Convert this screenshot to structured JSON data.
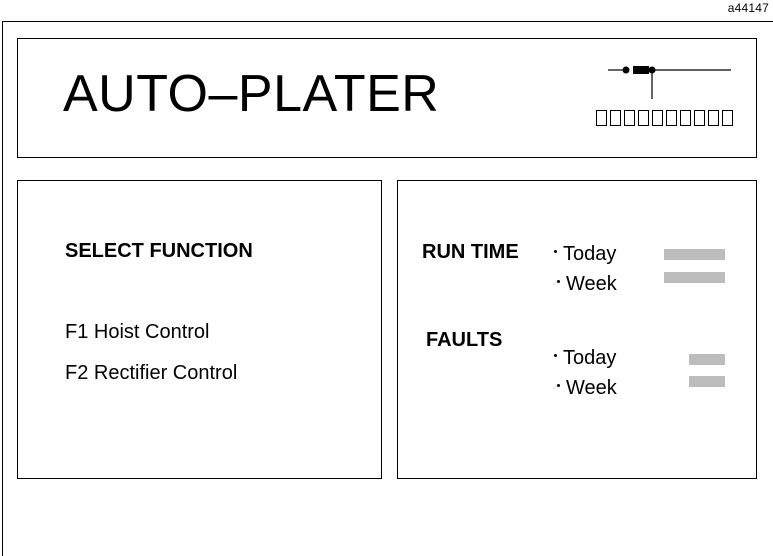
{
  "figure_id": "a44147",
  "header": {
    "title": "AUTO–PLATER"
  },
  "functions": {
    "heading": "SELECT FUNCTION",
    "items": [
      {
        "label": "F1 Hoist Control"
      },
      {
        "label": "F2 Rectifier Control"
      }
    ]
  },
  "stats": {
    "run_time": {
      "heading": "RUN TIME",
      "today_label": "Today",
      "week_label": "Week"
    },
    "faults": {
      "heading": "FAULTS",
      "today_label": "Today",
      "week_label": "Week"
    }
  },
  "colors": {
    "gauge": "#bcbcbc",
    "border": "#000000",
    "background": "#ffffff"
  },
  "icons": {
    "logo": "hoist-line-logo-icon"
  }
}
